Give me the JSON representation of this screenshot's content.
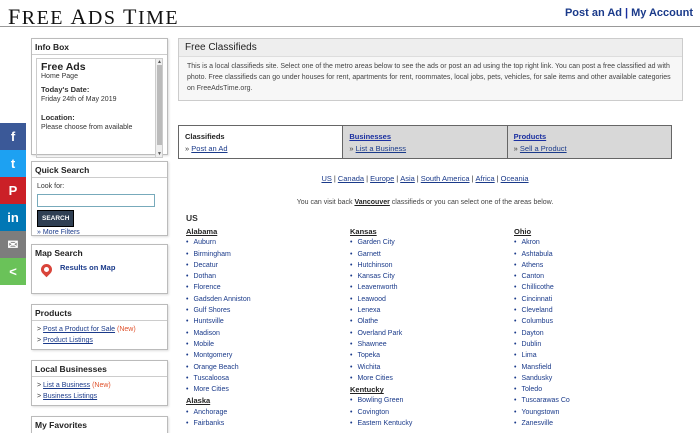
{
  "header": {
    "logo": [
      "F",
      "REE ",
      "A",
      "DS ",
      "T",
      "IME"
    ],
    "post_ad": "Post an Ad",
    "separator": "|",
    "my_account": "My Account"
  },
  "social": [
    {
      "icon": "facebook-icon",
      "glyph": "f",
      "color": "#3b5998"
    },
    {
      "icon": "twitter-icon",
      "glyph": "t",
      "color": "#1da1f2"
    },
    {
      "icon": "pinterest-icon",
      "glyph": "P",
      "color": "#cb2027"
    },
    {
      "icon": "linkedin-icon",
      "glyph": "in",
      "color": "#0077b5"
    },
    {
      "icon": "email-icon",
      "glyph": "✉",
      "color": "#7d7d7d"
    },
    {
      "icon": "share-icon",
      "glyph": "<",
      "color": "#6ac259"
    }
  ],
  "infobox": {
    "title": "Info Box",
    "site": "Free Ads",
    "page": "Home Page",
    "date_label": "Today's Date:",
    "date": "Friday 24th of May 2019",
    "location_label": "Location:",
    "location_text": "Please choose from available"
  },
  "quick_search": {
    "title": "Quick Search",
    "look_for": "Look for:",
    "button": "SEARCH",
    "more_filters": "» More Filters"
  },
  "map_search": {
    "title": "Map Search",
    "link": "Results on Map"
  },
  "products": {
    "title": "Products",
    "post": "Post a Product for Sale",
    "new": "(New)",
    "listings": "Product Listings"
  },
  "local_businesses": {
    "title": "Local Businesses",
    "list": "List a Business",
    "new": "(New)",
    "listings": "Business Listings"
  },
  "favorites": {
    "title": "My Favorites"
  },
  "intro": {
    "title": "Free Classifieds",
    "text": "This is a local classifieds site. Select one of the metro areas below to see the ads or post an ad using the top right link. You can post a free classified ad with photo. Free classifieds can go under houses for rent, apartments for rent, roommates, local jobs, pets, vehicles, for sale items and other available categories on FreeAdsTime.org."
  },
  "tabs": [
    {
      "title": "Classifieds",
      "sub": "Post an Ad"
    },
    {
      "title": "Businesses",
      "sub": "List a Business"
    },
    {
      "title": "Products",
      "sub": "Sell a Product"
    }
  ],
  "regions": [
    "US",
    "Canada",
    "Europe",
    "Asia",
    "South America",
    "Africa",
    "Oceania"
  ],
  "visit": {
    "before": "You can visit back ",
    "city": "Vancouver",
    "after": " classifieds or you can select one of the areas below."
  },
  "country": "US",
  "columns": [
    [
      {
        "state": "Alabama",
        "cities": [
          "Auburn",
          "Birmingham",
          "Decatur",
          "Dothan",
          "Florence",
          "Gadsden Anniston",
          "Gulf Shores",
          "Huntsville",
          "Madison",
          "Mobile",
          "Montgomery",
          "Orange Beach",
          "Tuscaloosa",
          "More Cities"
        ]
      },
      {
        "state": "Alaska",
        "cities": [
          "Anchorage",
          "Fairbanks"
        ]
      }
    ],
    [
      {
        "state": "Kansas",
        "cities": [
          "Garden City",
          "Garnett",
          "Hutchinson",
          "Kansas City",
          "Leavenworth",
          "Leawood",
          "Lenexa",
          "Olathe",
          "Overland Park",
          "Shawnee",
          "Topeka",
          "Wichita",
          "More Cities"
        ]
      },
      {
        "state": "Kentucky",
        "cities": [
          "Bowling Green",
          "Covington",
          "Eastern Kentucky"
        ]
      }
    ],
    [
      {
        "state": "Ohio",
        "cities": [
          "Akron",
          "Ashtabula",
          "Athens",
          "Canton",
          "Chillicothe",
          "Cincinnati",
          "Cleveland",
          "Columbus",
          "Dayton",
          "Dublin",
          "Lima",
          "Mansfield",
          "Sandusky",
          "Toledo",
          "Tuscarawas Co",
          "Youngstown",
          "Zanesville"
        ]
      }
    ]
  ]
}
